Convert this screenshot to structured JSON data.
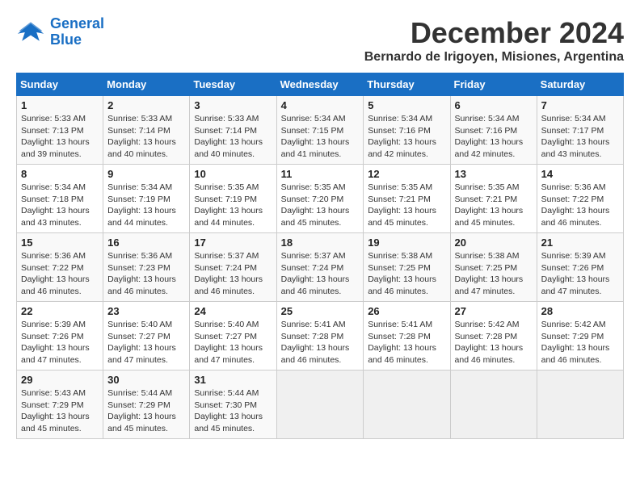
{
  "logo": {
    "line1": "General",
    "line2": "Blue"
  },
  "title": "December 2024",
  "subtitle": "Bernardo de Irigoyen, Misiones, Argentina",
  "days_header": [
    "Sunday",
    "Monday",
    "Tuesday",
    "Wednesday",
    "Thursday",
    "Friday",
    "Saturday"
  ],
  "weeks": [
    [
      {
        "day": "1",
        "info": "Sunrise: 5:33 AM\nSunset: 7:13 PM\nDaylight: 13 hours\nand 39 minutes."
      },
      {
        "day": "2",
        "info": "Sunrise: 5:33 AM\nSunset: 7:14 PM\nDaylight: 13 hours\nand 40 minutes."
      },
      {
        "day": "3",
        "info": "Sunrise: 5:33 AM\nSunset: 7:14 PM\nDaylight: 13 hours\nand 40 minutes."
      },
      {
        "day": "4",
        "info": "Sunrise: 5:34 AM\nSunset: 7:15 PM\nDaylight: 13 hours\nand 41 minutes."
      },
      {
        "day": "5",
        "info": "Sunrise: 5:34 AM\nSunset: 7:16 PM\nDaylight: 13 hours\nand 42 minutes."
      },
      {
        "day": "6",
        "info": "Sunrise: 5:34 AM\nSunset: 7:16 PM\nDaylight: 13 hours\nand 42 minutes."
      },
      {
        "day": "7",
        "info": "Sunrise: 5:34 AM\nSunset: 7:17 PM\nDaylight: 13 hours\nand 43 minutes."
      }
    ],
    [
      {
        "day": "8",
        "info": "Sunrise: 5:34 AM\nSunset: 7:18 PM\nDaylight: 13 hours\nand 43 minutes."
      },
      {
        "day": "9",
        "info": "Sunrise: 5:34 AM\nSunset: 7:19 PM\nDaylight: 13 hours\nand 44 minutes."
      },
      {
        "day": "10",
        "info": "Sunrise: 5:35 AM\nSunset: 7:19 PM\nDaylight: 13 hours\nand 44 minutes."
      },
      {
        "day": "11",
        "info": "Sunrise: 5:35 AM\nSunset: 7:20 PM\nDaylight: 13 hours\nand 45 minutes."
      },
      {
        "day": "12",
        "info": "Sunrise: 5:35 AM\nSunset: 7:21 PM\nDaylight: 13 hours\nand 45 minutes."
      },
      {
        "day": "13",
        "info": "Sunrise: 5:35 AM\nSunset: 7:21 PM\nDaylight: 13 hours\nand 45 minutes."
      },
      {
        "day": "14",
        "info": "Sunrise: 5:36 AM\nSunset: 7:22 PM\nDaylight: 13 hours\nand 46 minutes."
      }
    ],
    [
      {
        "day": "15",
        "info": "Sunrise: 5:36 AM\nSunset: 7:22 PM\nDaylight: 13 hours\nand 46 minutes."
      },
      {
        "day": "16",
        "info": "Sunrise: 5:36 AM\nSunset: 7:23 PM\nDaylight: 13 hours\nand 46 minutes."
      },
      {
        "day": "17",
        "info": "Sunrise: 5:37 AM\nSunset: 7:24 PM\nDaylight: 13 hours\nand 46 minutes."
      },
      {
        "day": "18",
        "info": "Sunrise: 5:37 AM\nSunset: 7:24 PM\nDaylight: 13 hours\nand 46 minutes."
      },
      {
        "day": "19",
        "info": "Sunrise: 5:38 AM\nSunset: 7:25 PM\nDaylight: 13 hours\nand 46 minutes."
      },
      {
        "day": "20",
        "info": "Sunrise: 5:38 AM\nSunset: 7:25 PM\nDaylight: 13 hours\nand 47 minutes."
      },
      {
        "day": "21",
        "info": "Sunrise: 5:39 AM\nSunset: 7:26 PM\nDaylight: 13 hours\nand 47 minutes."
      }
    ],
    [
      {
        "day": "22",
        "info": "Sunrise: 5:39 AM\nSunset: 7:26 PM\nDaylight: 13 hours\nand 47 minutes."
      },
      {
        "day": "23",
        "info": "Sunrise: 5:40 AM\nSunset: 7:27 PM\nDaylight: 13 hours\nand 47 minutes."
      },
      {
        "day": "24",
        "info": "Sunrise: 5:40 AM\nSunset: 7:27 PM\nDaylight: 13 hours\nand 47 minutes."
      },
      {
        "day": "25",
        "info": "Sunrise: 5:41 AM\nSunset: 7:28 PM\nDaylight: 13 hours\nand 46 minutes."
      },
      {
        "day": "26",
        "info": "Sunrise: 5:41 AM\nSunset: 7:28 PM\nDaylight: 13 hours\nand 46 minutes."
      },
      {
        "day": "27",
        "info": "Sunrise: 5:42 AM\nSunset: 7:28 PM\nDaylight: 13 hours\nand 46 minutes."
      },
      {
        "day": "28",
        "info": "Sunrise: 5:42 AM\nSunset: 7:29 PM\nDaylight: 13 hours\nand 46 minutes."
      }
    ],
    [
      {
        "day": "29",
        "info": "Sunrise: 5:43 AM\nSunset: 7:29 PM\nDaylight: 13 hours\nand 45 minutes."
      },
      {
        "day": "30",
        "info": "Sunrise: 5:44 AM\nSunset: 7:29 PM\nDaylight: 13 hours\nand 45 minutes."
      },
      {
        "day": "31",
        "info": "Sunrise: 5:44 AM\nSunset: 7:30 PM\nDaylight: 13 hours\nand 45 minutes."
      },
      {
        "day": "",
        "info": ""
      },
      {
        "day": "",
        "info": ""
      },
      {
        "day": "",
        "info": ""
      },
      {
        "day": "",
        "info": ""
      }
    ]
  ]
}
